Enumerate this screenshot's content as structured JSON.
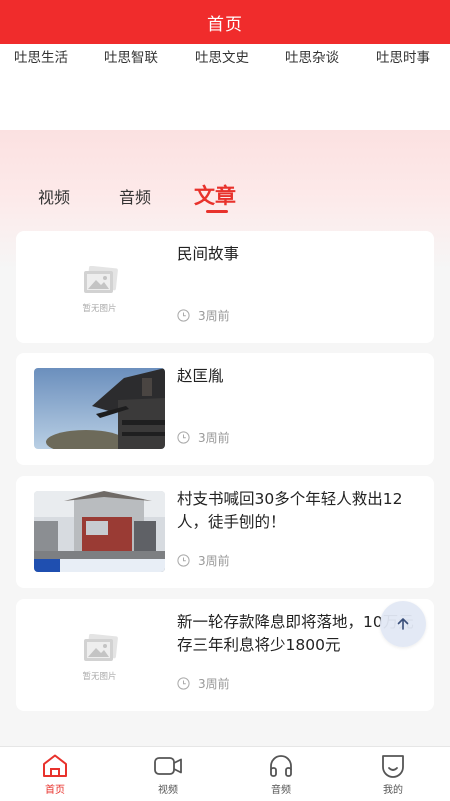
{
  "header": {
    "title": "首页"
  },
  "top_nav": {
    "items": [
      {
        "label": "吐思生活"
      },
      {
        "label": "吐思智联"
      },
      {
        "label": "吐思文史"
      },
      {
        "label": "吐思杂谈"
      },
      {
        "label": "吐思时事"
      }
    ]
  },
  "tabs": [
    {
      "label": "视频"
    },
    {
      "label": "音频"
    },
    {
      "label": "文章",
      "active": true
    }
  ],
  "articles": [
    {
      "title": "民间故事",
      "time": "3周前",
      "thumbnail": "placeholder",
      "placeholder_text": "暂无图片"
    },
    {
      "title": "赵匡胤",
      "time": "3周前",
      "thumbnail": "photo-temple-eaves"
    },
    {
      "title": "村支书喊回30多个年轻人救出12人，徒手刨的！",
      "time": "3周前",
      "thumbnail": "photo-news-truck",
      "thumbnail_caption": "团结村里的“团结小分队”"
    },
    {
      "title": "新一轮存款降息即将落地，10万元存三年利息将少1800元",
      "time": "3周前",
      "thumbnail": "placeholder",
      "placeholder_text": "暂无图片"
    }
  ],
  "back_to_top": {
    "icon": "arrow-up-icon"
  },
  "bottom_nav": {
    "items": [
      {
        "label": "首页",
        "icon": "home-icon",
        "active": true
      },
      {
        "label": "视频",
        "icon": "video-icon"
      },
      {
        "label": "音频",
        "icon": "headphones-icon"
      },
      {
        "label": "我的",
        "icon": "profile-icon"
      }
    ]
  },
  "colors": {
    "brand_red": "#f02c2c",
    "accent_red": "#e8322c"
  }
}
